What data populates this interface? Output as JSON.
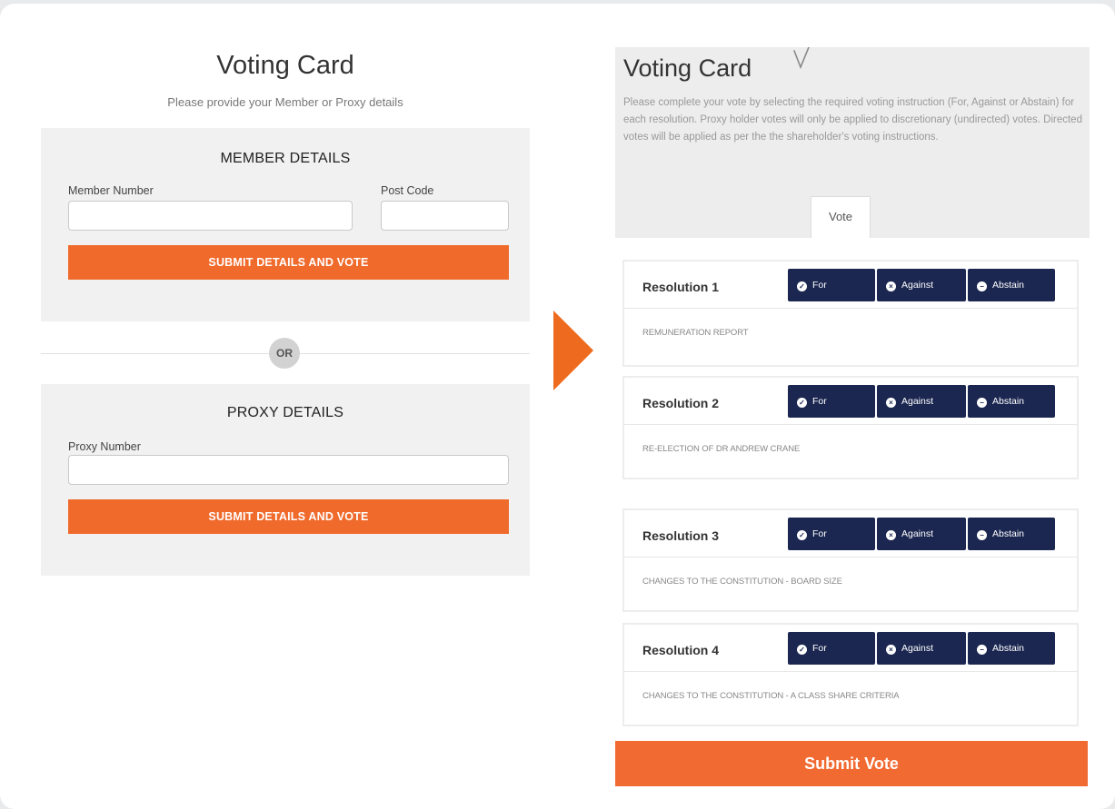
{
  "left": {
    "title": "Voting Card",
    "subtitle": "Please provide your Member or Proxy details",
    "member": {
      "heading": "MEMBER DETAILS",
      "member_number_label": "Member Number",
      "member_number_value": "",
      "post_code_label": "Post Code",
      "post_code_value": "",
      "submit_label": "SUBMIT DETAILS AND VOTE"
    },
    "or_label": "OR",
    "proxy": {
      "heading": "PROXY DETAILS",
      "proxy_number_label": "Proxy Number",
      "proxy_number_value": "",
      "submit_label": "SUBMIT DETAILS AND VOTE"
    }
  },
  "right": {
    "title": "Voting Card",
    "description": "Please complete your vote by selecting the required voting instruction (For, Against or Abstain) for each resolution. Proxy holder votes will only be applied to discretionary (undirected) votes. Directed votes will be applied as per the the shareholder's voting instructions.",
    "tab_label": "Vote",
    "resolutions": [
      {
        "name": "Resolution 1",
        "description": "REMUNERATION REPORT"
      },
      {
        "name": "Resolution 2",
        "description": "RE-ELECTION OF DR ANDREW CRANE"
      },
      {
        "name": "Resolution 3",
        "description": "CHANGES TO THE CONSTITUTION - BOARD SIZE"
      },
      {
        "name": "Resolution 4",
        "description": "CHANGES TO THE CONSTITUTION - A CLASS SHARE CRITERIA"
      }
    ],
    "vote_options": {
      "for": "For",
      "against": "Against",
      "abstain": "Abstain"
    },
    "submit_label": "Submit Vote"
  },
  "icons": {
    "for": "check-circle-icon",
    "against": "x-circle-icon",
    "abstain": "minus-circle-icon",
    "arrow": "arrow-right-icon"
  },
  "colors": {
    "accent_orange": "#f06a2c",
    "vote_button_navy": "#1b2751",
    "panel_gray": "#f1f1f1"
  }
}
